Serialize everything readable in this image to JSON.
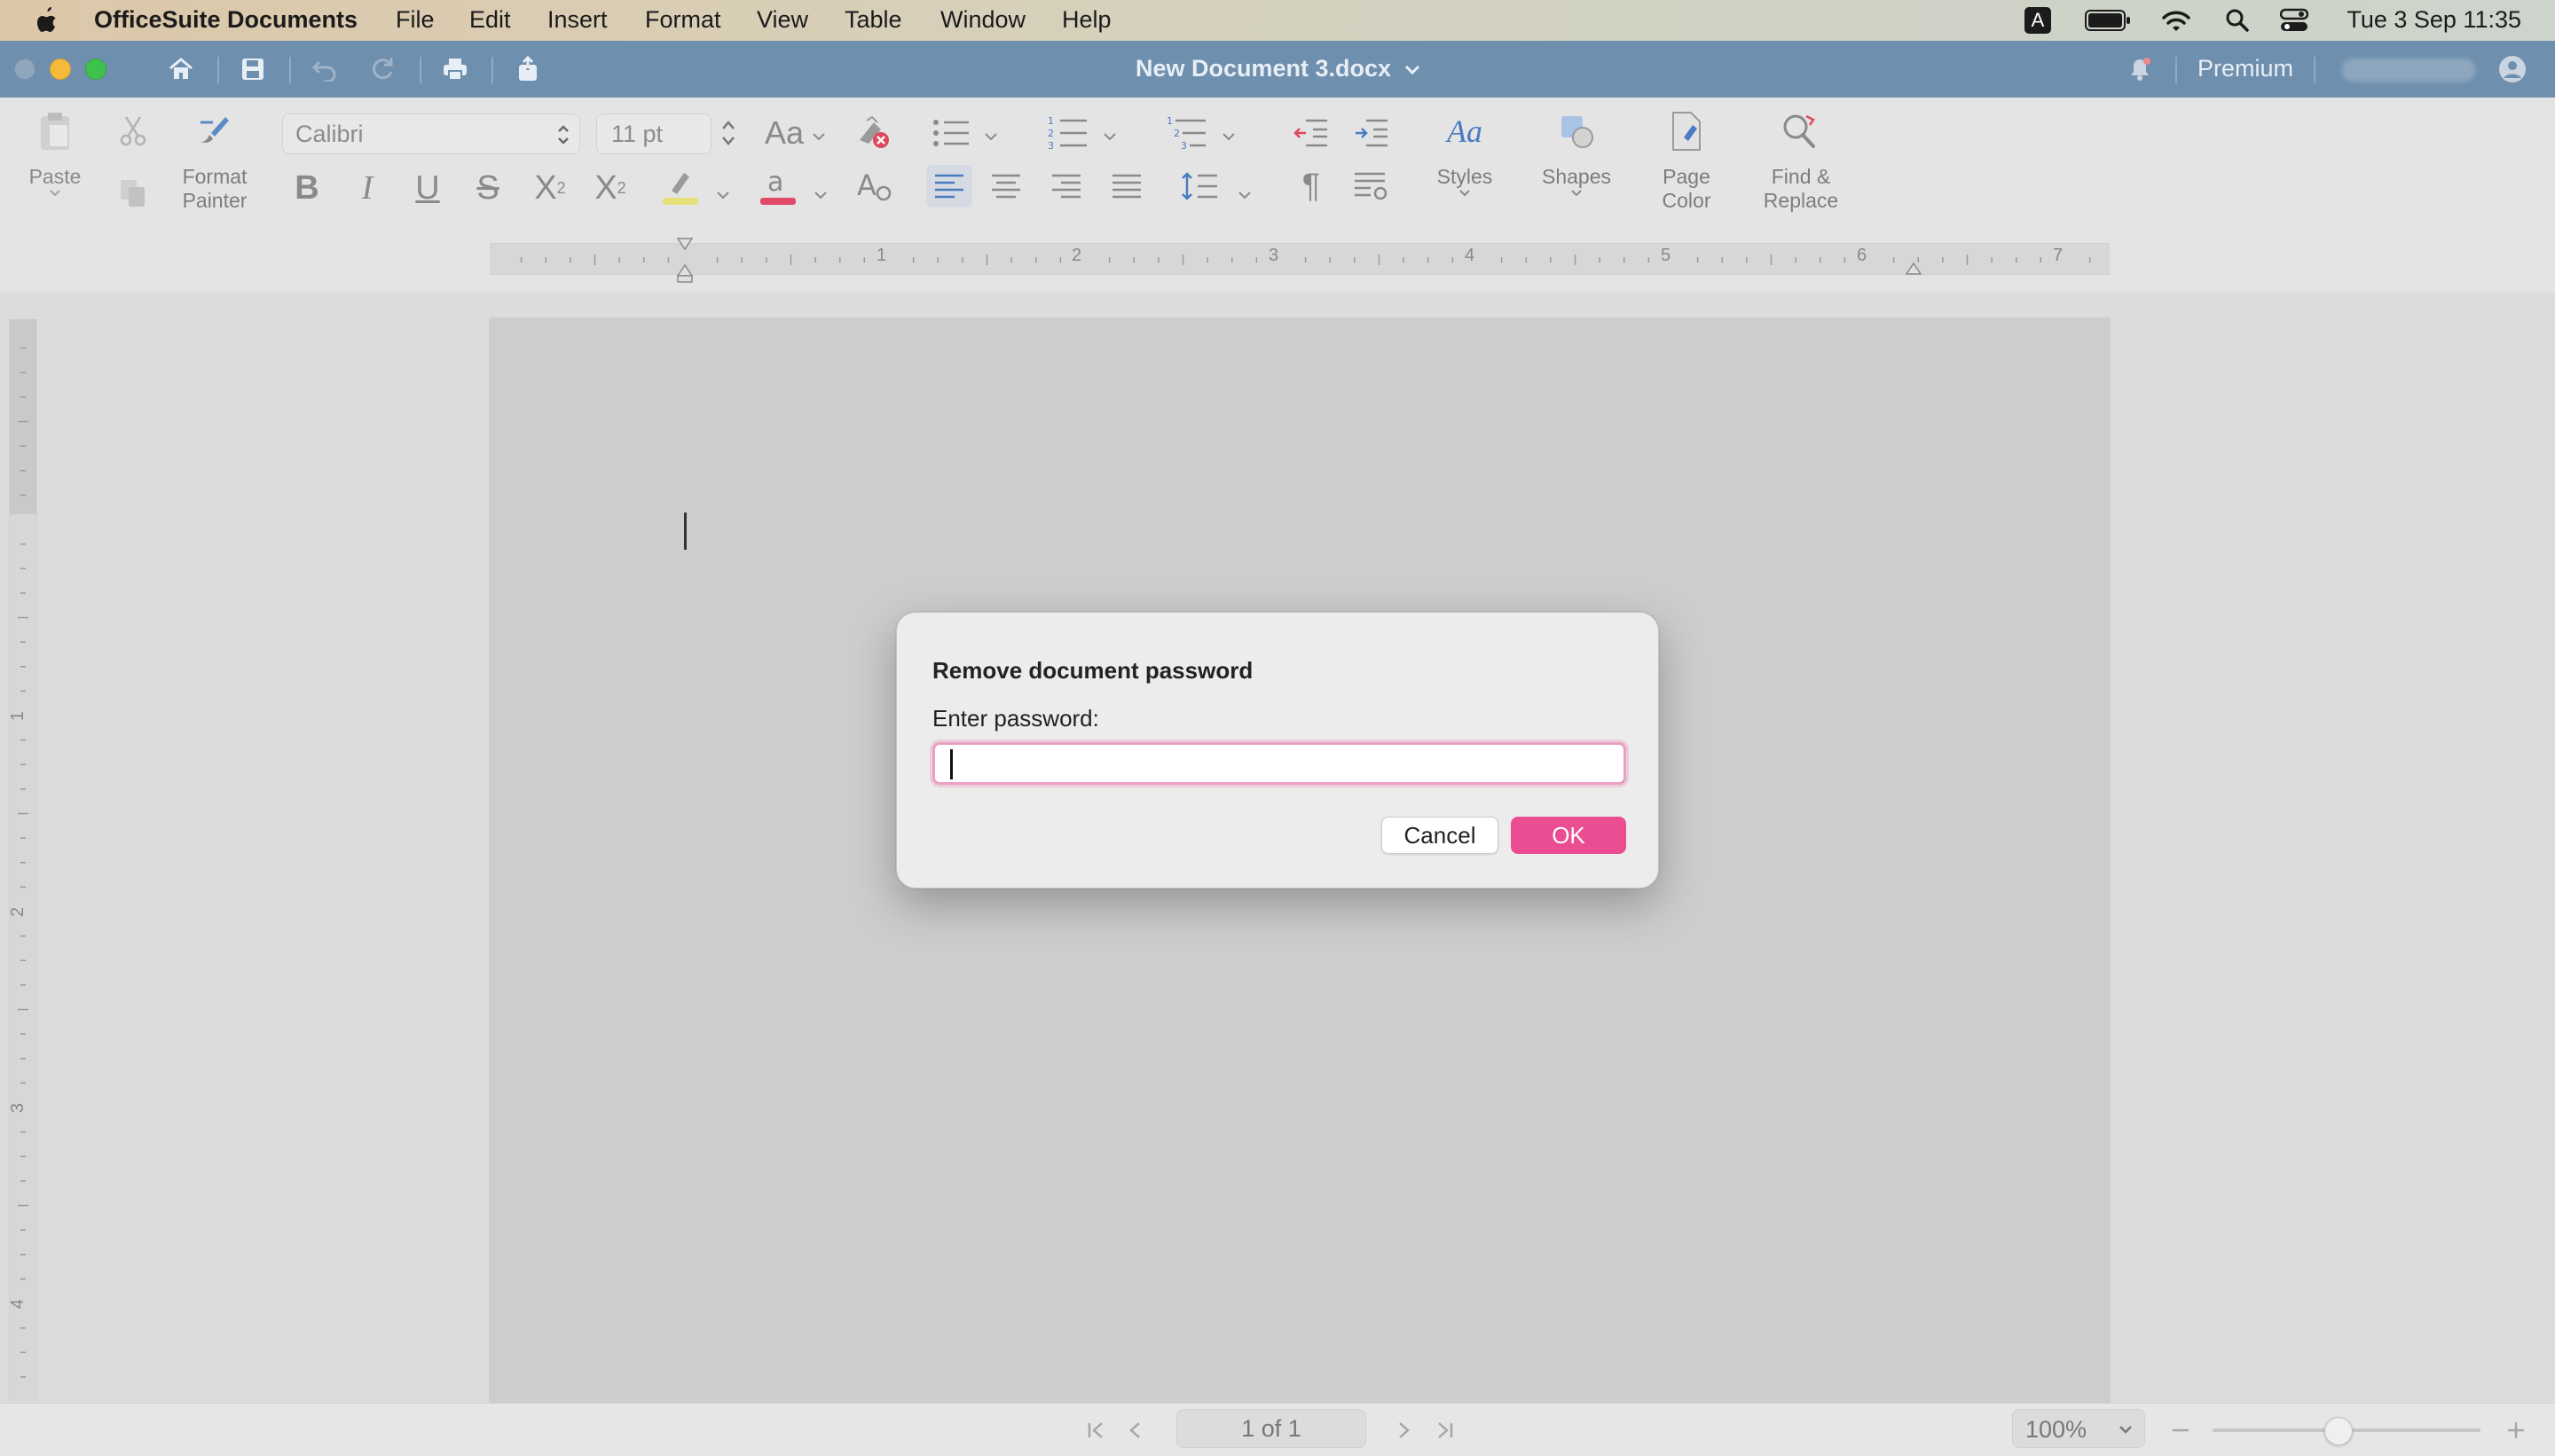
{
  "menubar": {
    "app_name": "OfficeSuite Documents",
    "menus": [
      "File",
      "Edit",
      "Insert",
      "Format",
      "View",
      "Table",
      "Window",
      "Help"
    ],
    "input_source": "A",
    "clock": "Tue 3 Sep  11:35"
  },
  "titlebar": {
    "document_title": "New Document 3.docx",
    "premium_label": "Premium"
  },
  "ribbon": {
    "paste_label": "Paste",
    "format_painter_label": "Format Painter",
    "font_name": "Calibri",
    "font_size": "11 pt",
    "styles_label": "Styles",
    "shapes_label": "Shapes",
    "page_color_label": "Page Color",
    "find_replace_label": "Find & Replace",
    "underline_color": "#e34a6a",
    "highlight_color": "#e6e07a"
  },
  "ruler": {
    "h_numbers": [
      "1",
      "2",
      "3",
      "4",
      "5",
      "6",
      "7"
    ],
    "v_numbers": [
      "1",
      "2",
      "3",
      "4"
    ]
  },
  "dialog": {
    "title": "Remove document password",
    "label": "Enter password:",
    "password_value": "",
    "cancel_label": "Cancel",
    "ok_label": "OK",
    "accent_color": "#ea4d92"
  },
  "statusbar": {
    "page_indicator": "1 of 1",
    "zoom": "100%"
  }
}
